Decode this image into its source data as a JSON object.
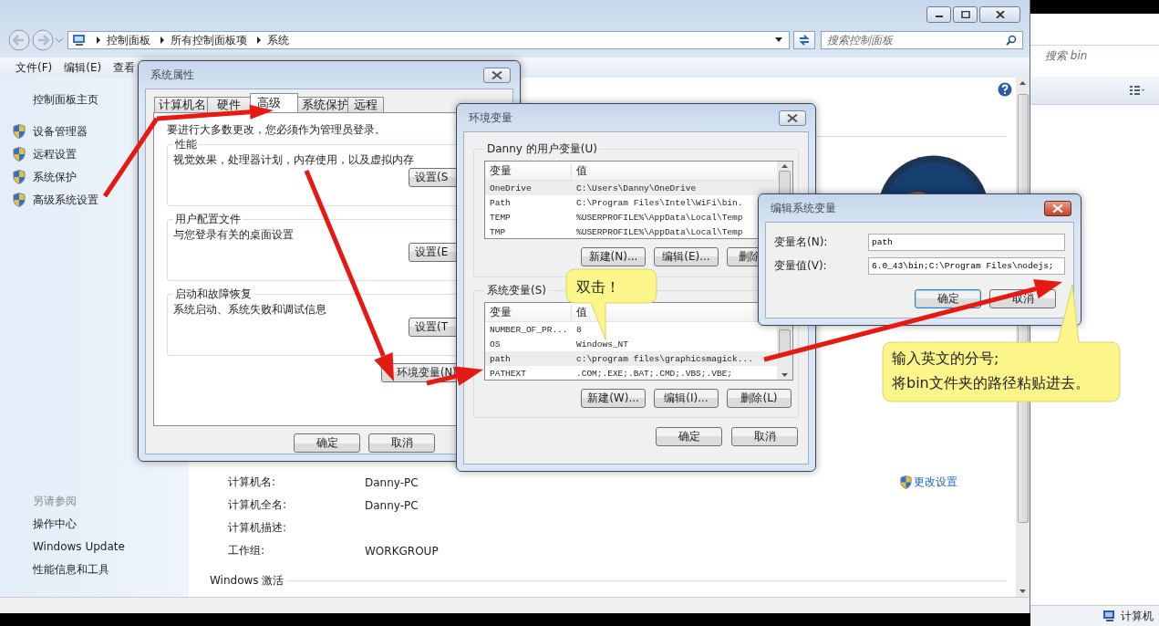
{
  "explorer": {
    "breadcrumb": [
      "控制面板",
      "所有控制面板项",
      "系统"
    ],
    "search_placeholder": "搜索控制面板",
    "menu": [
      "文件(F)",
      "编辑(E)",
      "查看"
    ],
    "sidebar": {
      "home": "控制面板主页",
      "links": [
        "设备管理器",
        "远程设置",
        "系统保护",
        "高级系统设置"
      ],
      "see_also_title": "另请参阅",
      "see_also": [
        "操作中心",
        "Windows Update",
        "性能信息和工具"
      ]
    },
    "computer_info": [
      {
        "label": "计算机名:",
        "value": "Danny-PC"
      },
      {
        "label": "计算机全名:",
        "value": "Danny-PC"
      },
      {
        "label": "计算机描述:"
      },
      {
        "label": "工作组:",
        "value": "WORKGROUP"
      }
    ],
    "change_settings_link": "更改设置",
    "activation_heading": "Windows 激活"
  },
  "back_window": {
    "search_placeholder": "搜索 bin",
    "status": "计算机"
  },
  "system_properties": {
    "title": "系统属性",
    "tabs": [
      {
        "label": "计算机名",
        "selected": false
      },
      {
        "label": "硬件",
        "selected": false
      },
      {
        "label": "高级",
        "selected": true
      },
      {
        "label": "系统保护",
        "selected": false
      },
      {
        "label": "远程",
        "selected": false
      }
    ],
    "admin_note": "要进行大多数更改，您必须作为管理员登录。",
    "groups": [
      {
        "title": "性能",
        "description": "视觉效果，处理器计划，内存使用，以及虚拟内存",
        "button": "设置(S"
      },
      {
        "title": "用户配置文件",
        "description": "与您登录有关的桌面设置",
        "button": "设置(E"
      },
      {
        "title": "启动和故障恢复",
        "description": "系统启动、系统失败和调试信息",
        "button": "设置(T"
      }
    ],
    "env_button": "环境变量(N)",
    "buttons": [
      "确定",
      "取消"
    ]
  },
  "environment_variables": {
    "title": "环境变量",
    "user_group": "Danny 的用户变量(U)",
    "columns": [
      "变量",
      "值"
    ],
    "user_rows": [
      {
        "name": "OneDrive",
        "value": "C:\\Users\\Danny\\OneDrive",
        "selected": true
      },
      {
        "name": "Path",
        "value": "C:\\Program Files\\Intel\\WiFi\\bin.",
        "selected": false
      },
      {
        "name": "TEMP",
        "value": "%USERPROFILE%\\AppData\\Local\\Temp",
        "selected": false
      },
      {
        "name": "TMP",
        "value": "%USERPROFILE%\\AppData\\Local\\Temp",
        "selected": false
      }
    ],
    "user_buttons": [
      "新建(N)...",
      "编辑(E)...",
      "删除"
    ],
    "system_group": "系统变量(S)",
    "system_columns": [
      "变量",
      "值"
    ],
    "system_rows": [
      {
        "name": "NUMBER_OF_PR...",
        "value": "8",
        "selected": false
      },
      {
        "name": "OS",
        "value": "Windows_NT",
        "selected": false
      },
      {
        "name": "path",
        "value": "c:\\program files\\graphicsmagick...",
        "selected": true
      },
      {
        "name": "PATHEXT",
        "value": ".COM;.EXE;.BAT;.CMD;.VBS;.VBE;",
        "selected": false
      }
    ],
    "system_buttons": [
      "新建(W)...",
      "编辑(I)...",
      "删除(L)"
    ],
    "buttons": [
      "确定",
      "取消"
    ]
  },
  "edit_variable": {
    "title": "编辑系统变量",
    "name_label": "变量名(N):",
    "name_value": "path",
    "value_label": "变量值(V):",
    "value": "6.0_43\\bin;C:\\Program Files\\nodejs;",
    "buttons": [
      {
        "label": "确定",
        "default": true
      },
      {
        "label": "取消",
        "default": false
      }
    ]
  },
  "callouts": {
    "double_click": "双击！",
    "instruction_lines": [
      "输入英文的分号;",
      "将bin文件夹的路径粘贴进去。"
    ]
  }
}
